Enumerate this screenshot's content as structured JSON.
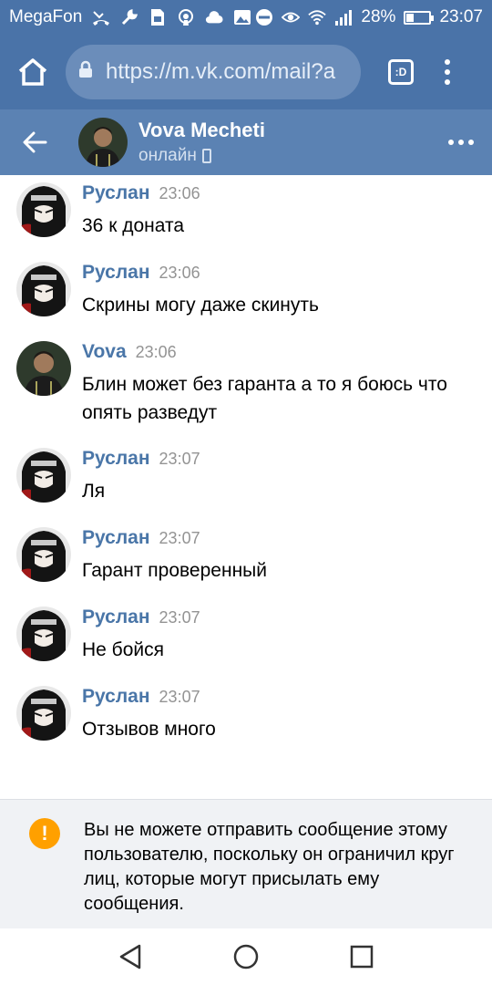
{
  "status_bar": {
    "carrier": "MegaFon",
    "battery_percent": "28%",
    "battery_level": 0.28,
    "time": "23:07"
  },
  "browser": {
    "url": "https://m.vk.com/mail?a",
    "tabs_label": ":D"
  },
  "header": {
    "name": "Vova Mecheti",
    "status": "онлайн"
  },
  "messages": [
    {
      "author": "Руслан",
      "time": "23:06",
      "text": "36 к доната",
      "avatar": "ruslan"
    },
    {
      "author": "Руслан",
      "time": "23:06",
      "text": "Скрины могу даже скинуть",
      "avatar": "ruslan"
    },
    {
      "author": "Vova",
      "time": "23:06",
      "text": "Блин может без гаранта а то я боюсь что опять разведут",
      "avatar": "vova"
    },
    {
      "author": "Руслан",
      "time": "23:07",
      "text": "Ля",
      "avatar": "ruslan"
    },
    {
      "author": "Руслан",
      "time": "23:07",
      "text": "Гарант проверенный",
      "avatar": "ruslan"
    },
    {
      "author": "Руслан",
      "time": "23:07",
      "text": "Не бойся",
      "avatar": "ruslan"
    },
    {
      "author": "Руслан",
      "time": "23:07",
      "text": "Отзывов много",
      "avatar": "ruslan"
    }
  ],
  "notice": {
    "icon_text": "!",
    "text": "Вы не можете отправить сообщение этому пользователю, поскольку он ограничил круг лиц, которые могут присылать ему сообщения."
  },
  "colors": {
    "status_bar": "#4a73a8",
    "header": "#5b82b3",
    "author": "#4a76a8",
    "warning": "#ffa000"
  }
}
